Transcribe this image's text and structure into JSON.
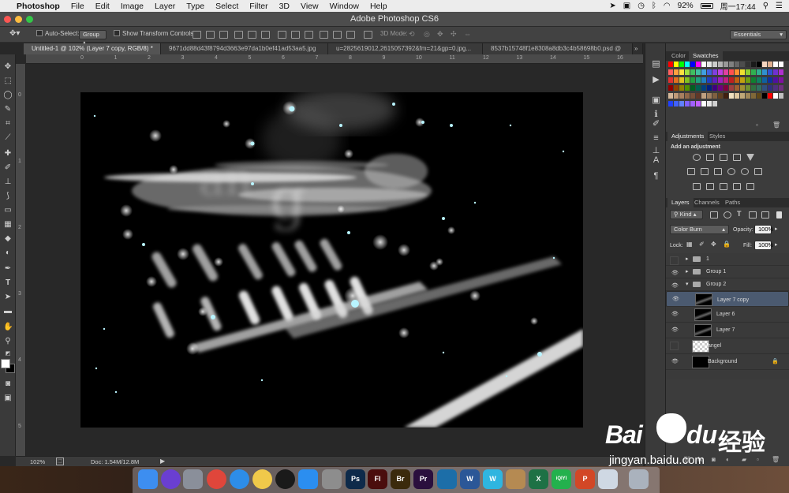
{
  "menubar": {
    "apple": "",
    "app_name": "Photoshop",
    "items": [
      "File",
      "Edit",
      "Image",
      "Layer",
      "Type",
      "Select",
      "Filter",
      "3D",
      "View",
      "Window",
      "Help"
    ],
    "battery": "92%",
    "clock": "周一17:44"
  },
  "window": {
    "title": "Adobe Photoshop CS6"
  },
  "options_bar": {
    "auto_select_label": "Auto-Select:",
    "auto_select_value": "Group",
    "show_transform_label": "Show Transform Controls",
    "mode_3d_label": "3D Mode:",
    "workspace": "Essentials"
  },
  "tabs": [
    {
      "label": "Untitled-1 @ 102% (Layer 7 copy, RGB/8) *",
      "active": true
    },
    {
      "label": "9671dd88d43f8794d3663e97da1b0ef41ad53aa5.jpg",
      "active": false
    },
    {
      "label": "u=2825619012,2615057392&fm=21&gp=0.jpg...",
      "active": false
    },
    {
      "label": "8537b15748f1e8308a8db3c4b58698b0.psd @",
      "active": false
    }
  ],
  "ruler_h_labels": [
    "0",
    "1",
    "2",
    "3",
    "4",
    "5",
    "6",
    "7",
    "8",
    "9",
    "10",
    "11",
    "12",
    "13",
    "14",
    "15",
    "16",
    "17"
  ],
  "ruler_v_labels": [
    "0",
    "1",
    "2",
    "3",
    "4",
    "5"
  ],
  "status": {
    "zoom": "102%",
    "doc": "Doc: 1.54M/12.8M"
  },
  "color_panel": {
    "tabs": [
      "Color",
      "Swatches"
    ]
  },
  "adjustments_panel": {
    "tabs": [
      "Adjustments",
      "Styles"
    ],
    "heading": "Add an adjustment"
  },
  "layers_panel": {
    "tabs": [
      "Layers",
      "Channels",
      "Paths"
    ],
    "kind_label": "Kind",
    "blend_mode": "Color Burn",
    "opacity_label": "Opacity:",
    "opacity_value": "100%",
    "lock_label": "Lock:",
    "fill_label": "Fill:",
    "fill_value": "100%",
    "layers": [
      {
        "name": "1",
        "type": "group",
        "visible": false,
        "indent": 0,
        "selected": false
      },
      {
        "name": "Group 1",
        "type": "group",
        "visible": true,
        "indent": 0,
        "selected": false
      },
      {
        "name": "Group 2",
        "type": "group-open",
        "visible": true,
        "indent": 0,
        "selected": false
      },
      {
        "name": "Layer 7 copy",
        "type": "layer",
        "visible": true,
        "indent": 1,
        "selected": true
      },
      {
        "name": "Layer 6",
        "type": "layer",
        "visible": true,
        "indent": 1,
        "selected": false
      },
      {
        "name": "Layer 7",
        "type": "layer",
        "visible": true,
        "indent": 1,
        "selected": false
      },
      {
        "name": "angel",
        "type": "transparent",
        "visible": false,
        "indent": 0,
        "selected": false
      },
      {
        "name": "Background",
        "type": "background",
        "visible": true,
        "indent": 0,
        "selected": false
      }
    ]
  },
  "dock": {
    "apps": [
      {
        "name": "finder",
        "label": "",
        "color": "#3d8ef0"
      },
      {
        "name": "siri",
        "label": "",
        "color": "#6a3fd1"
      },
      {
        "name": "launchpad",
        "label": "",
        "color": "#8a8f9a"
      },
      {
        "name": "chrome",
        "label": "",
        "color": "#e0463b"
      },
      {
        "name": "safari",
        "label": "",
        "color": "#2d8de8"
      },
      {
        "name": "photos",
        "label": "",
        "color": "#f0c94a"
      },
      {
        "name": "qq",
        "label": "",
        "color": "#1a1a1a"
      },
      {
        "name": "app-store",
        "label": "",
        "color": "#2b8ef0"
      },
      {
        "name": "system-preferences",
        "label": "",
        "color": "#8d8d8d"
      },
      {
        "name": "photoshop",
        "label": "Ps",
        "color": "#0e2a4a"
      },
      {
        "name": "flash",
        "label": "Fl",
        "color": "#4a0d0d"
      },
      {
        "name": "bridge",
        "label": "Br",
        "color": "#3b2a0c"
      },
      {
        "name": "premiere",
        "label": "Pr",
        "color": "#2a0f3d"
      },
      {
        "name": "browser",
        "label": "",
        "color": "#1c6ea8"
      },
      {
        "name": "word",
        "label": "W",
        "color": "#2b5797"
      },
      {
        "name": "wps",
        "label": "W",
        "color": "#2fb5e0"
      },
      {
        "name": "archive",
        "label": "",
        "color": "#b58a52"
      },
      {
        "name": "excel",
        "label": "X",
        "color": "#1e7145"
      },
      {
        "name": "iqiyi",
        "label": "iQIYI",
        "color": "#23b14d"
      },
      {
        "name": "powerpoint",
        "label": "P",
        "color": "#d24726"
      },
      {
        "name": "preview",
        "label": "",
        "color": "#cfd8e3"
      },
      {
        "name": "trash",
        "label": "",
        "color": "#aab2bd"
      }
    ]
  },
  "watermark": {
    "brand": "Bai",
    "brand2": "du",
    "cn": "经验",
    "url": "jingyan.baidu.com"
  }
}
